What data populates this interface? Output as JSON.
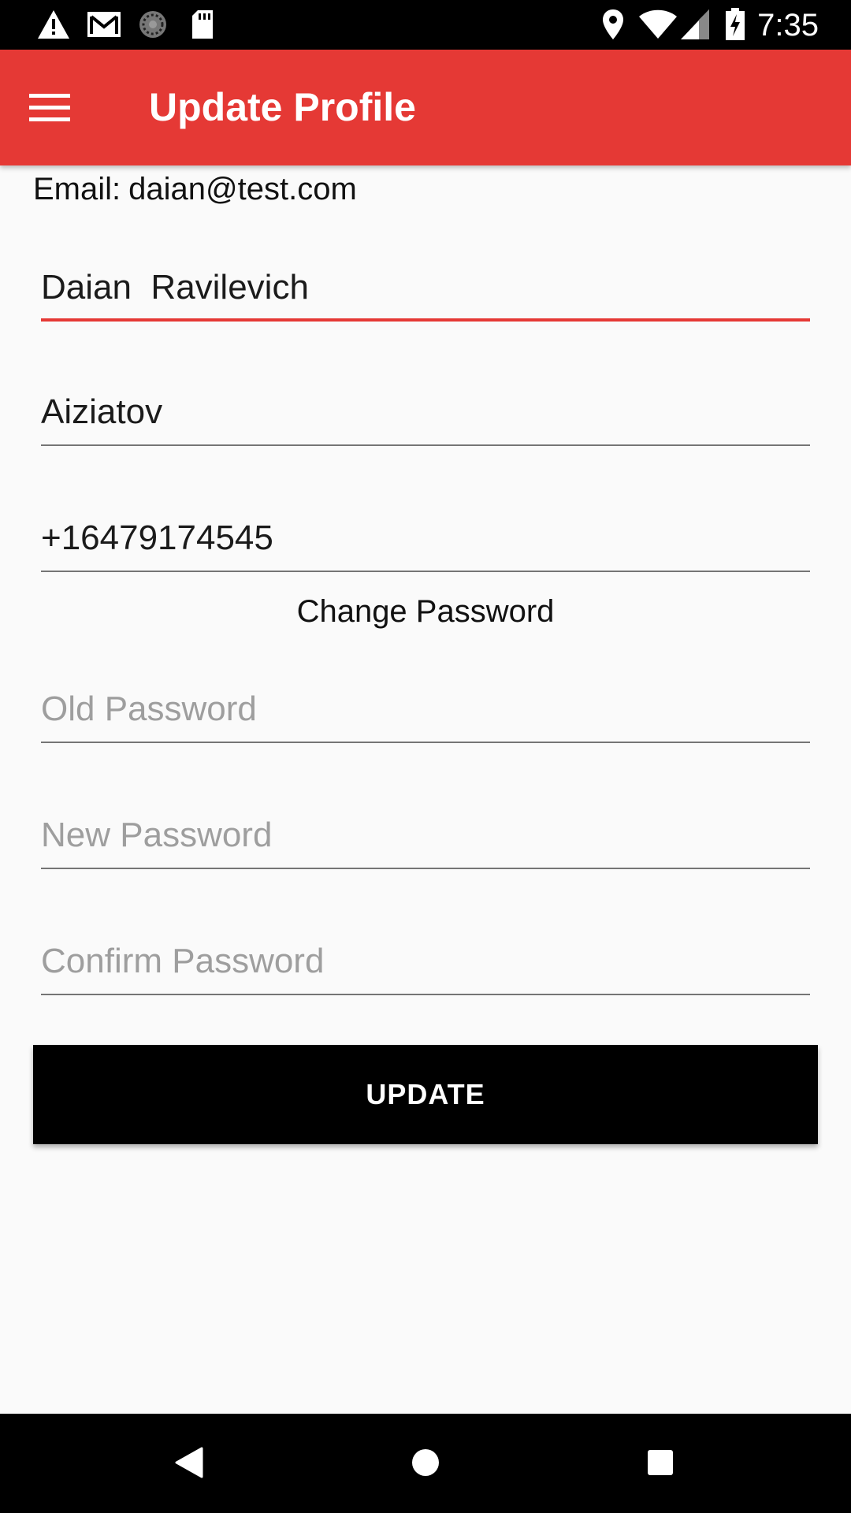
{
  "status_bar": {
    "time": "7:35",
    "left_icons": [
      "warning-icon",
      "gmail-icon",
      "sync-icon",
      "sd-card-icon"
    ],
    "right_icons": [
      "location-icon",
      "wifi-icon",
      "signal-icon",
      "battery-charging-icon"
    ]
  },
  "app_bar": {
    "title": "Update Profile",
    "menu_icon": "hamburger-menu-icon",
    "color": "#e53935"
  },
  "profile": {
    "email_label": "Email:",
    "email_value": "daian@test.com"
  },
  "form": {
    "first_name": {
      "value": "Daian  Ravilevich",
      "focused": true
    },
    "last_name": {
      "value": "Aiziatov"
    },
    "phone": {
      "value": "+16479174545"
    },
    "change_password_label": "Change Password",
    "old_password": {
      "value": "",
      "placeholder": "Old Password"
    },
    "new_password": {
      "value": "",
      "placeholder": "New Password"
    },
    "confirm_password": {
      "value": "",
      "placeholder": "Confirm Password"
    },
    "update_button_label": "UPDATE"
  },
  "nav_bar": {
    "icons": [
      "back-icon",
      "home-icon",
      "recents-icon"
    ]
  },
  "colors": {
    "accent": "#e53935",
    "button": "#000000",
    "background": "#fafafa"
  }
}
